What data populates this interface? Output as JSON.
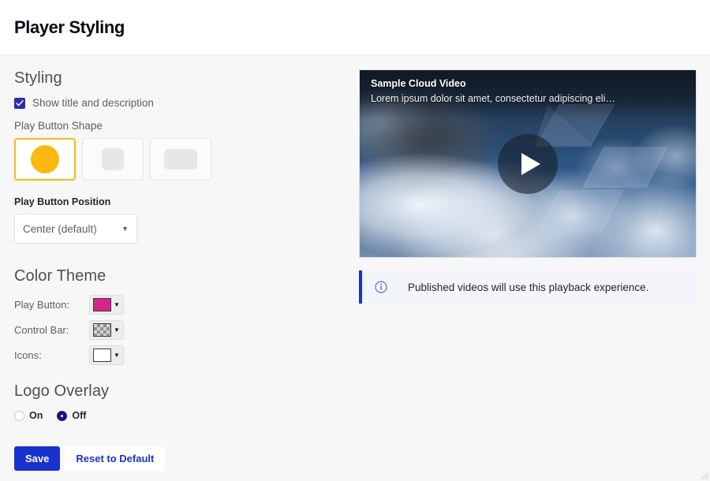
{
  "header": {
    "title": "Player Styling"
  },
  "styling": {
    "heading": "Styling",
    "show_title_checkbox": {
      "label": "Show title and description",
      "checked": true,
      "icon": "check-icon"
    },
    "play_button_shape": {
      "label": "Play Button Shape",
      "options": [
        {
          "name": "circle",
          "selected": true
        },
        {
          "name": "rounded-square",
          "selected": false
        },
        {
          "name": "rounded-rectangle",
          "selected": false
        }
      ],
      "selected_color": "#fcb913"
    },
    "play_button_position": {
      "label": "Play Button Position",
      "value": "Center (default)",
      "caret_icon": "chevron-down-icon"
    }
  },
  "color_theme": {
    "heading": "Color Theme",
    "rows": [
      {
        "label": "Play Button:",
        "color": "#d6258a",
        "swatch_type": "solid",
        "caret_icon": "chevron-down-icon"
      },
      {
        "label": "Control Bar:",
        "color": "transparent",
        "swatch_type": "checker",
        "caret_icon": "chevron-down-icon"
      },
      {
        "label": "Icons:",
        "color": "#ffffff",
        "swatch_type": "solid",
        "caret_icon": "chevron-down-icon"
      }
    ]
  },
  "logo_overlay": {
    "heading": "Logo Overlay",
    "options": [
      {
        "label": "On",
        "selected": false
      },
      {
        "label": "Off",
        "selected": true
      }
    ]
  },
  "actions": {
    "save_label": "Save",
    "reset_label": "Reset to Default",
    "primary_color": "#1833cc"
  },
  "preview": {
    "video_title": "Sample Cloud Video",
    "video_description": "Lorem ipsum dolor sit amet, consectetur adipiscing eli…",
    "play_icon": "play-triangle-icon",
    "logo_watermark_icon": "hexagon-logo-icon"
  },
  "notice": {
    "icon": "info-circle-icon",
    "text": "Published videos will use this playback experience.",
    "accent_color": "#1833cc"
  }
}
